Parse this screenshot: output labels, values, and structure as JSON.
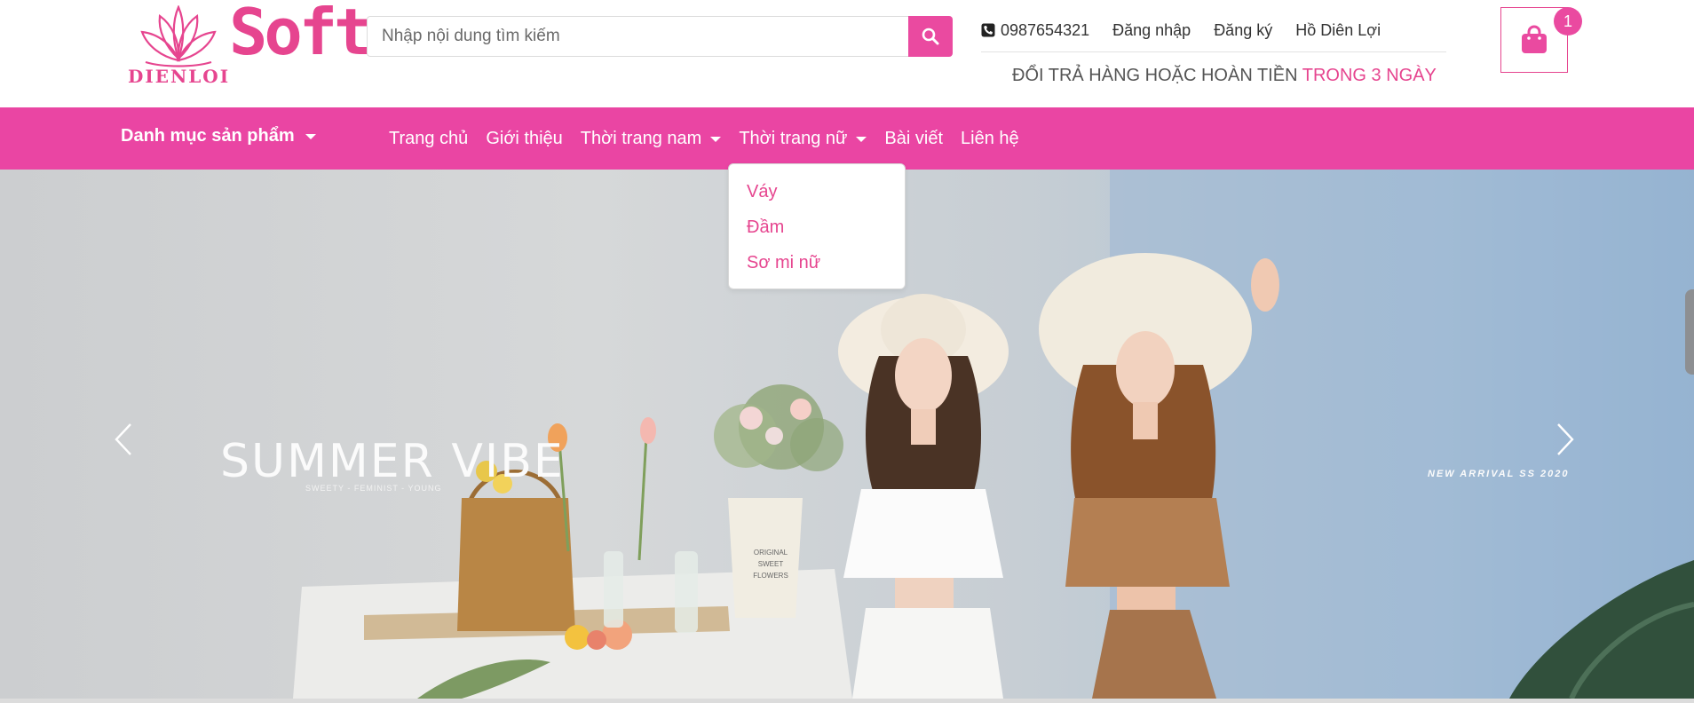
{
  "brand": {
    "logo_word": "Soft",
    "logo_sub": "DIENLOI",
    "accent_color": "#ea45a3"
  },
  "search": {
    "placeholder": "Nhập nội dung tìm kiếm",
    "value": "",
    "button_icon": "search-icon"
  },
  "top_links": {
    "phone_icon": "phone-icon",
    "phone": "0987654321",
    "login": "Đăng nhập",
    "register": "Đăng ký",
    "user": "Hồ Diên Lợi"
  },
  "promo": {
    "text": "ĐỔI TRẢ HÀNG HOẶC HOÀN TIỀN",
    "highlight": "TRONG 3 NGÀY"
  },
  "cart": {
    "icon": "shopping-bag-icon",
    "count": "1"
  },
  "nav": {
    "category_label": "Danh mục sản phẩm",
    "items": [
      {
        "label": "Trang chủ"
      },
      {
        "label": "Giới thiệu"
      },
      {
        "label": "Thời trang nam"
      },
      {
        "label": "Thời trang nữ"
      },
      {
        "label": "Bài viết"
      },
      {
        "label": "Liên hệ"
      }
    ]
  },
  "dropdown": {
    "items": [
      {
        "label": "Váy"
      },
      {
        "label": "Đầm"
      },
      {
        "label": "Sơ mi nữ"
      }
    ]
  },
  "banner": {
    "title": "SUMMER VIBE",
    "subtitle": "SWEETY - FEMINIST - YOUNG",
    "tag": "NEW ARRIVAL SS 2020",
    "bucket_text": "ORIGINAL\nSWEET\nFLOWERS",
    "prev_icon": "chevron-left-icon",
    "next_icon": "chevron-right-icon"
  }
}
